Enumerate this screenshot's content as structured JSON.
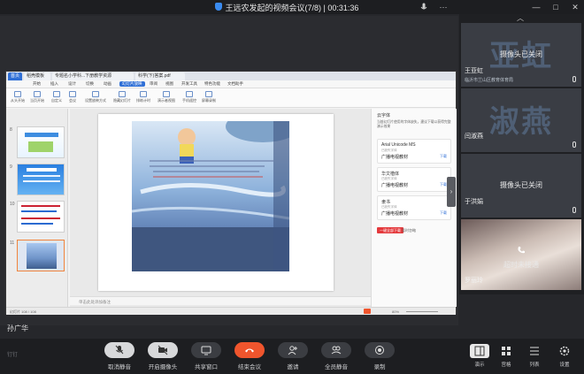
{
  "window": {
    "title": "王远农发起的视频会议(7/8) | 00:31:36"
  },
  "shared_screen": {
    "wps": {
      "tabs": [
        "首页",
        "稻壳模板",
        "专题名小学科...下册教学资源",
        "科学(下)答案.pdf"
      ],
      "menu": [
        "开始",
        "插入",
        "设计",
        "切换",
        "动画",
        "幻灯片放映",
        "审阅",
        "视图",
        "开发工具",
        "特色功能",
        "文档助手"
      ],
      "active_menu": "幻灯片放映",
      "ribbon": [
        "从头开始",
        "当页开始",
        "自定义",
        "会议",
        "设置放映方式",
        "隐藏幻灯片",
        "排练计时",
        "演示者视图",
        "手机遥控",
        "屏幕录制"
      ],
      "thumb_numbers": [
        "8",
        "9",
        "10",
        "11"
      ],
      "notes_placeholder": "单击此处添加备注",
      "status_left": "幻灯片 108 / 108",
      "status_right": "80%",
      "font_panel": {
        "title": "云字体",
        "notice": "当前幻灯片使用的字体缺失，建议下载以获得完整演示效果",
        "items": [
          {
            "name": "Arial Unicode MS",
            "status": "已缺失字体",
            "preview": "广播电视教材",
            "action": "下载"
          },
          {
            "name": "华文楷体",
            "status": "已缺失字体",
            "preview": "广播电视教材",
            "action": "下载"
          },
          {
            "name": "隶书",
            "status": "已缺失字体",
            "preview": "广播电视教材",
            "action": "下载"
          }
        ],
        "button_download": "一键全部下载",
        "button_ignore": "暂时忽略"
      }
    },
    "presenter_name": "孙广华"
  },
  "gallery": {
    "participants": [
      {
        "big_text": "亚虹",
        "camera_text": "摄像头已关闭",
        "name": "王亚虹",
        "org": "临沂市兰山区教育体育局"
      },
      {
        "big_text": "淑燕",
        "camera_text": "摄像头已关闭",
        "name": "闫淑燕",
        "org": ""
      },
      {
        "big_text": "",
        "camera_text": "摄像头已关闭",
        "name": "于洪娟",
        "org": ""
      },
      {
        "big_text": "",
        "camera_text": "超时未接通",
        "name": "罗丽玲",
        "org": ""
      }
    ]
  },
  "toolbar": {
    "logo": "钉钉",
    "buttons": [
      "取消静音",
      "开启摄像头",
      "共享窗口",
      "结束会议",
      "邀请",
      "全员静音",
      "录制"
    ],
    "right_buttons": [
      "演示",
      "宫格",
      "列表",
      "设置"
    ]
  },
  "colors": {
    "end_meeting": "#f0552d",
    "accent": "#2f6fd6"
  }
}
